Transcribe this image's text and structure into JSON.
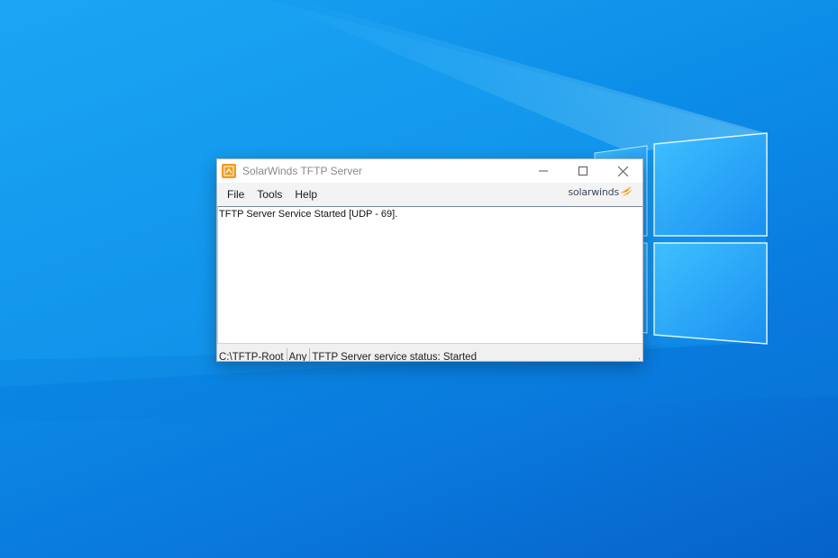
{
  "window": {
    "title": "SolarWinds TFTP Server",
    "app_icon": "solarwinds-tftp-icon"
  },
  "caption_buttons": {
    "minimize_icon": "minimize-icon",
    "maximize_icon": "maximize-icon",
    "close_icon": "close-icon"
  },
  "menu": {
    "items": [
      "File",
      "Tools",
      "Help"
    ]
  },
  "brand": {
    "text": "solarwinds",
    "logo_icon": "solarwinds-logo-icon"
  },
  "log": {
    "lines": [
      "TFTP Server Service Started [UDP - 69]."
    ]
  },
  "status": {
    "root_folder": "C:\\TFTP-Root",
    "bind": "Any",
    "service_status": "TFTP Server service status: Started"
  },
  "colors": {
    "accent": "#f39a1e",
    "desktop": "#0c8ee8"
  }
}
